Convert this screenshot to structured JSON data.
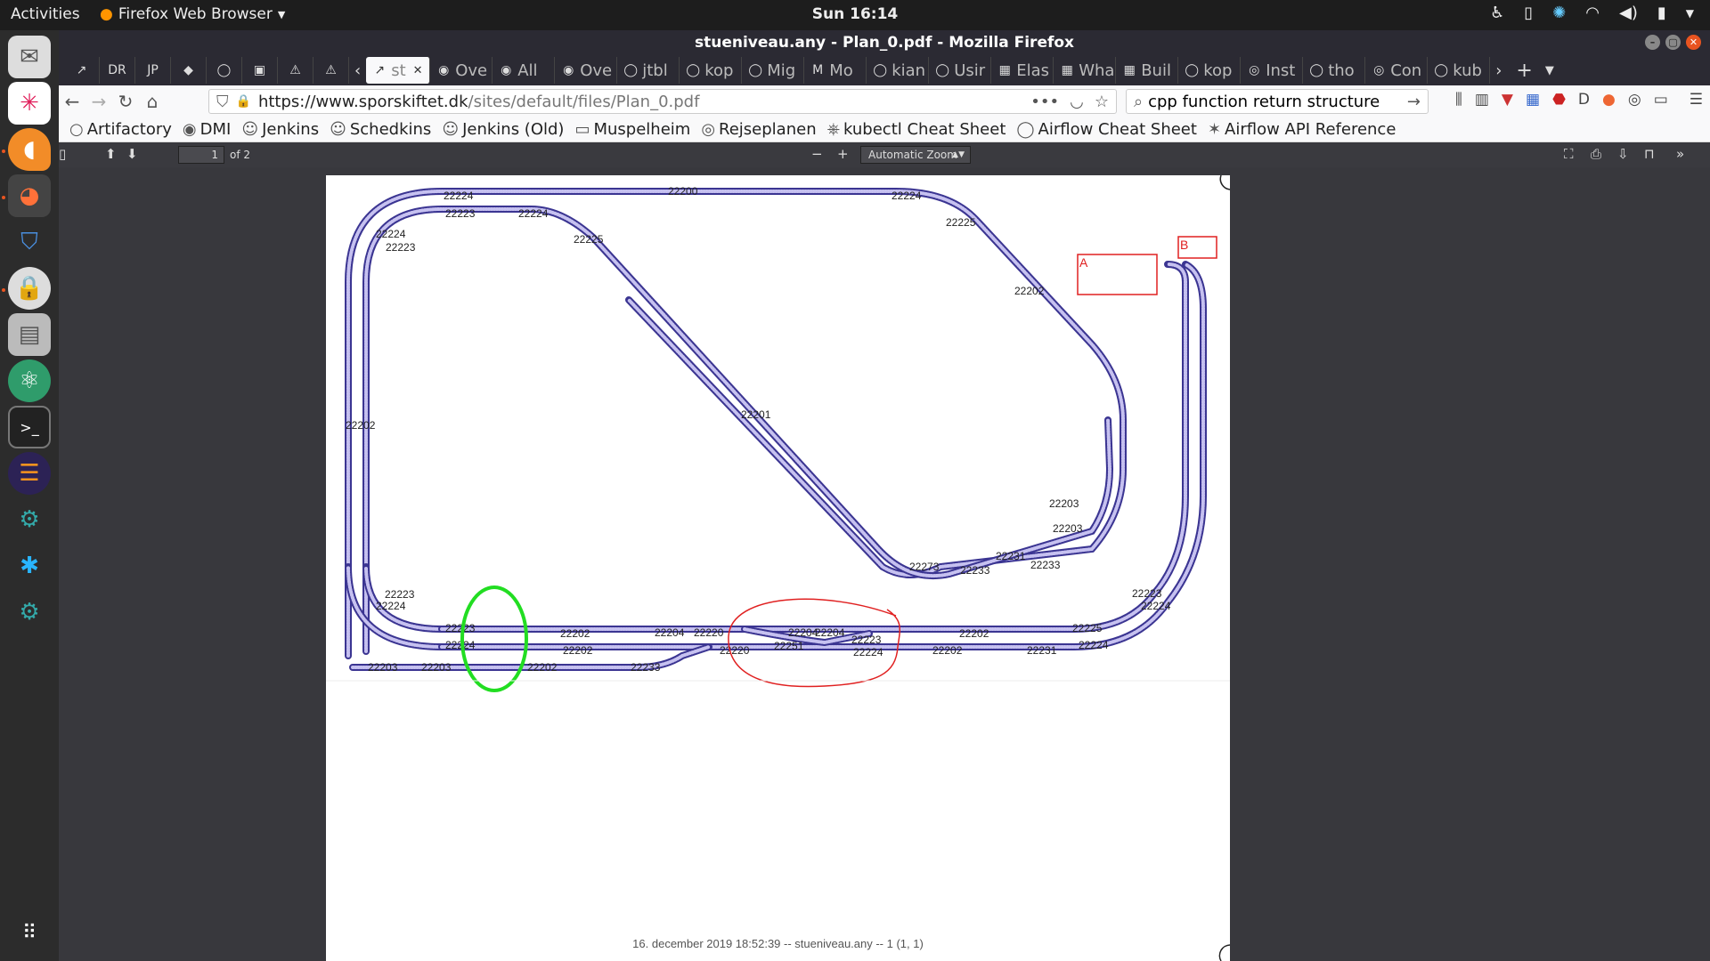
{
  "topbar": {
    "activities": "Activities",
    "app_name": "Firefox Web Browser",
    "clock": "Sun 16:14"
  },
  "dock": {
    "apps": [
      {
        "name": "mail-icon"
      },
      {
        "name": "slack-icon"
      },
      {
        "name": "sublime-icon"
      },
      {
        "name": "firefox-icon"
      },
      {
        "name": "vpn-icon"
      },
      {
        "name": "password-manager-icon"
      },
      {
        "name": "files-icon"
      },
      {
        "name": "atom-icon"
      },
      {
        "name": "terminal-icon"
      },
      {
        "name": "eclipse-icon"
      },
      {
        "name": "app-icon"
      },
      {
        "name": "snowflake-icon"
      },
      {
        "name": "app-icon"
      }
    ]
  },
  "window": {
    "title": "stueniveau.any - Plan_0.pdf - Mozilla Firefox"
  },
  "tabs": [
    {
      "label": "",
      "pinned": true,
      "glyph": "↗"
    },
    {
      "label": "",
      "pinned": true,
      "glyph": "DR"
    },
    {
      "label": "",
      "pinned": true,
      "glyph": "JP"
    },
    {
      "label": "",
      "pinned": true,
      "glyph": "◆"
    },
    {
      "label": "",
      "pinned": true,
      "glyph": "◯"
    },
    {
      "label": "",
      "pinned": true,
      "glyph": "▣"
    },
    {
      "label": "",
      "pinned": true,
      "glyph": "⚠"
    },
    {
      "label": "",
      "pinned": true,
      "glyph": "⚠"
    },
    {
      "label": "st",
      "active": true,
      "glyph": "↗"
    },
    {
      "label": "Ove",
      "glyph": "◉"
    },
    {
      "label": "All",
      "glyph": "◉"
    },
    {
      "label": "Ove",
      "glyph": "◉"
    },
    {
      "label": "jtbl",
      "glyph": "◯"
    },
    {
      "label": "kop",
      "glyph": "◯"
    },
    {
      "label": "Mig",
      "glyph": "◯"
    },
    {
      "label": "Mo",
      "glyph": "M"
    },
    {
      "label": "kian",
      "glyph": "◯"
    },
    {
      "label": "Usir",
      "glyph": "◯"
    },
    {
      "label": "Elas",
      "glyph": "▦"
    },
    {
      "label": "Wha",
      "glyph": "▦"
    },
    {
      "label": "Buil",
      "glyph": "▦"
    },
    {
      "label": "kop",
      "glyph": "◯"
    },
    {
      "label": "Inst",
      "glyph": "◎"
    },
    {
      "label": "tho",
      "glyph": "◯"
    },
    {
      "label": "Con",
      "glyph": "◎"
    },
    {
      "label": "kub",
      "glyph": "◯"
    }
  ],
  "nav": {
    "url_host": "https://www.sporskiftet.dk",
    "url_path": "/sites/default/files/Plan_0.pdf",
    "search_value": "cpp function return structure"
  },
  "bookmarks": [
    {
      "label": "Artifactory",
      "icon": "○"
    },
    {
      "label": "DMI",
      "icon": "◉"
    },
    {
      "label": "Jenkins",
      "icon": "☺"
    },
    {
      "label": "Schedkins",
      "icon": "☺"
    },
    {
      "label": "Jenkins (Old)",
      "icon": "☺"
    },
    {
      "label": "Muspelheim",
      "icon": "▭"
    },
    {
      "label": "Rejseplanen",
      "icon": "◎"
    },
    {
      "label": "kubectl Cheat Sheet",
      "icon": "⎈"
    },
    {
      "label": "Airflow Cheat Sheet",
      "icon": "◯"
    },
    {
      "label": "Airflow API Reference",
      "icon": "✶"
    }
  ],
  "pdf": {
    "page_number": "1",
    "page_count": "of 2",
    "zoom": "Automatic Zoom",
    "footer": "16. december 2019 18:52:39 -- stueniveau.any -- 1 (1, 1)",
    "annotation_a": "A",
    "annotation_b": "B",
    "track_labels": [
      {
        "text": "22224"
      },
      {
        "text": "22200"
      },
      {
        "text": "22224"
      },
      {
        "text": "22223"
      },
      {
        "text": "22224"
      },
      {
        "text": "22225"
      },
      {
        "text": "22224"
      },
      {
        "text": "22223"
      },
      {
        "text": "22225"
      },
      {
        "text": "22202"
      },
      {
        "text": "22201"
      },
      {
        "text": "22202"
      },
      {
        "text": "22203"
      },
      {
        "text": "22203"
      },
      {
        "text": "22231"
      },
      {
        "text": "22233"
      },
      {
        "text": "22273"
      },
      {
        "text": "22233"
      },
      {
        "text": "22223"
      },
      {
        "text": "22224"
      },
      {
        "text": "22223"
      },
      {
        "text": "22224"
      },
      {
        "text": "22223"
      },
      {
        "text": "22224"
      },
      {
        "text": "22202"
      },
      {
        "text": "22204"
      },
      {
        "text": "22220"
      },
      {
        "text": "22204"
      },
      {
        "text": "22204"
      },
      {
        "text": "22202"
      },
      {
        "text": "22225"
      },
      {
        "text": "22202"
      },
      {
        "text": "22220"
      },
      {
        "text": "22251"
      },
      {
        "text": "22202"
      },
      {
        "text": "22231"
      },
      {
        "text": "22224"
      },
      {
        "text": "22203"
      },
      {
        "text": "22203"
      },
      {
        "text": "22202"
      },
      {
        "text": "22233"
      },
      {
        "text": "22223"
      },
      {
        "text": "22224"
      }
    ]
  }
}
